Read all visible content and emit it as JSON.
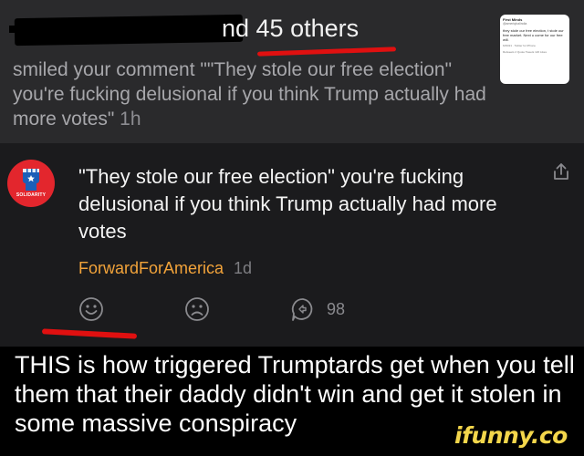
{
  "notification": {
    "headline": "nd 45 others",
    "body": "smiled your comment \"\"They stole our free election\" you're fucking delusional if you think Trump actually had more votes\"",
    "time": "1h",
    "thumbnail": {
      "name": "First Minds",
      "handle": "@ameriqbalindia",
      "text": "they stole our free election, t stole our free market. Next u come for our free will.",
      "date": "6/29/21 · Twitter for iPhone",
      "stats": "Retweets  2 Quote Tweets  120 Likes"
    }
  },
  "comment": {
    "text": "\"They stole our free election\" you're fucking delusional if you think Trump actually had more votes",
    "author": "ForwardForAmerica",
    "time": "1d",
    "reply_count": "98",
    "avatar_label": "SOLIDARITY"
  },
  "caption": "THIS is how triggered Trumptards get when you tell them that their daddy didn't win and get it stolen in some massive conspiracy",
  "watermark": "ifunny.co",
  "colors": {
    "author": "#f2a33a",
    "annotation": "#e01010",
    "avatar": "#e3262d",
    "watermark": "#f3d64b"
  },
  "icons": [
    "share-icon",
    "smile-icon",
    "frown-icon",
    "reply-icon",
    "fist-icon"
  ]
}
